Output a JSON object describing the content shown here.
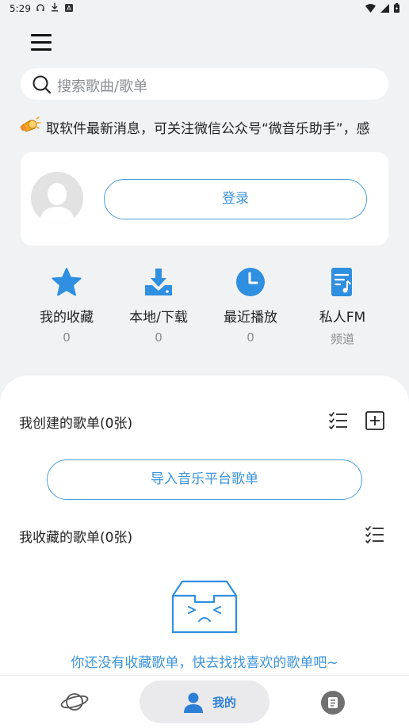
{
  "status_bar": {
    "time": "5:29",
    "left_icons": [
      "headphones-icon",
      "download-icon",
      "a-icon"
    ],
    "right_icons": [
      "wifi-icon",
      "signal-icon",
      "battery-icon"
    ]
  },
  "search": {
    "placeholder": "搜索歌曲/歌单"
  },
  "notice": {
    "text": "取软件最新消息，可关注微信公众号“微音乐助手”，感"
  },
  "user_card": {
    "login_label": "登录"
  },
  "quick_actions": [
    {
      "icon": "star-icon",
      "label": "我的收藏",
      "count": "0"
    },
    {
      "icon": "download-icon",
      "label": "本地/下载",
      "count": "0"
    },
    {
      "icon": "clock-icon",
      "label": "最近播放",
      "count": "0"
    },
    {
      "icon": "music-note-icon",
      "label": "私人FM",
      "count": "频道"
    }
  ],
  "created_playlists": {
    "title": "我创建的歌单(0张)",
    "import_label": "导入音乐平台歌单"
  },
  "collected_playlists": {
    "title": "我收藏的歌单(0张)",
    "empty_text": "你还没有收藏歌单，快去找找喜欢的歌单吧~"
  },
  "bottom_nav": {
    "mine_label": "我的"
  },
  "colors": {
    "accent": "#2f8fe0",
    "background": "#f1f2f4",
    "card": "#ffffff"
  }
}
